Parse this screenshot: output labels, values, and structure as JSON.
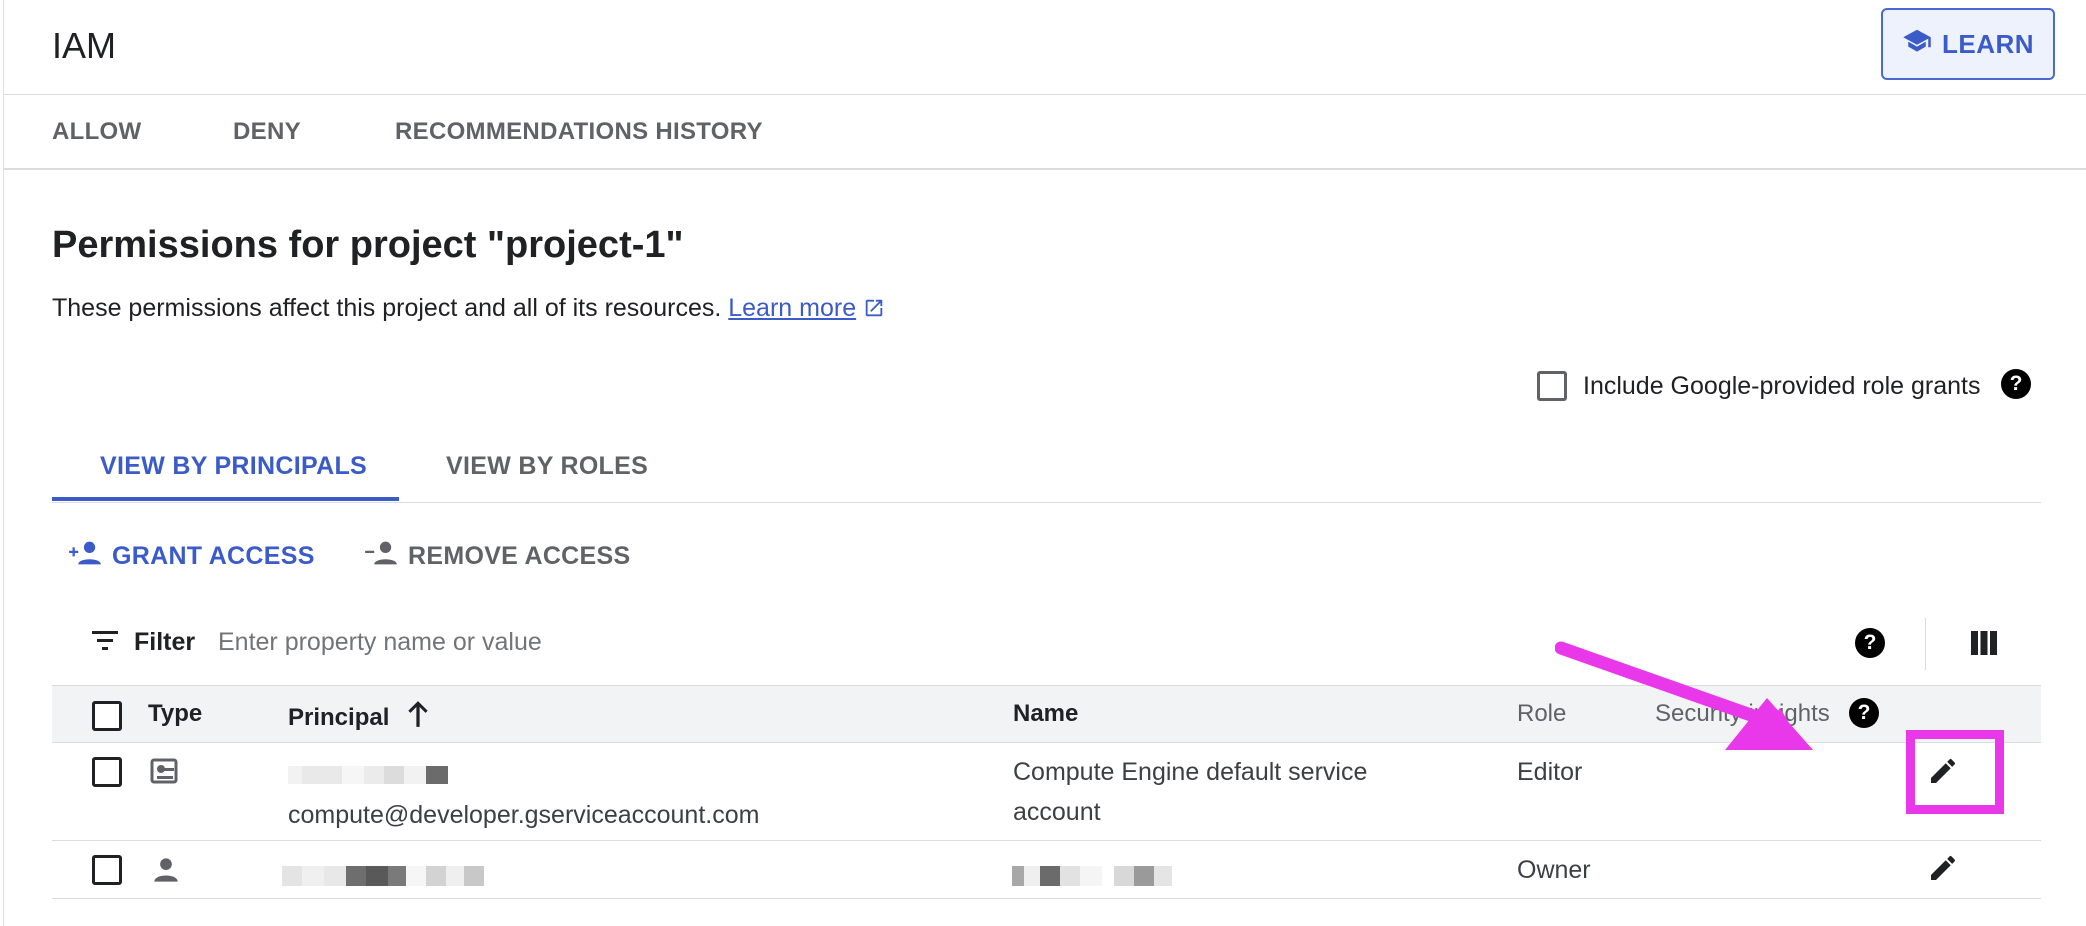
{
  "header": {
    "title": "IAM",
    "learn_label": "LEARN"
  },
  "top_tabs": [
    "ALLOW",
    "DENY",
    "RECOMMENDATIONS HISTORY"
  ],
  "page": {
    "title": "Permissions for project \"project-1\"",
    "description": "These permissions affect this project and all of its resources.",
    "learn_more": "Learn more"
  },
  "include_google_label": "Include Google-provided role grants",
  "view_tabs": {
    "active": "VIEW BY PRINCIPALS",
    "other": "VIEW BY ROLES"
  },
  "actions": {
    "grant": "GRANT ACCESS",
    "remove": "REMOVE ACCESS"
  },
  "filter": {
    "label": "Filter",
    "placeholder": "Enter property name or value"
  },
  "table": {
    "headers": {
      "type": "Type",
      "principal": "Principal",
      "name": "Name",
      "role": "Role",
      "security_insights": "Security insights"
    },
    "rows": [
      {
        "type_icon": "service-account-icon",
        "principal": "compute@developer.gserviceaccount.com",
        "name_line1": "Compute Engine default service",
        "name_line2": "account",
        "role": "Editor"
      },
      {
        "type_icon": "person-icon",
        "principal": "",
        "name": "",
        "role": "Owner"
      }
    ]
  },
  "colors": {
    "accent": "#3b5bc8",
    "annotation": "#e838ea"
  }
}
